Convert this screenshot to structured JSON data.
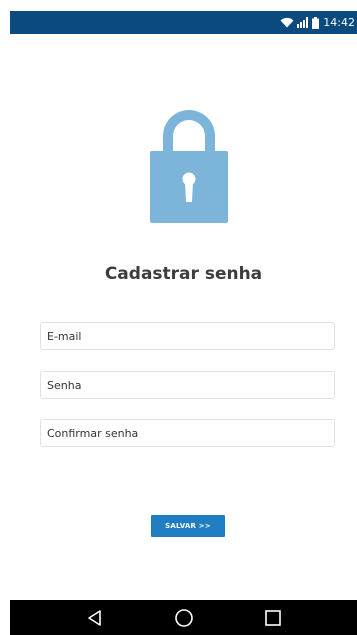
{
  "status_bar": {
    "time": "14:42",
    "icons": [
      "wifi-icon",
      "signal-icon",
      "battery-icon"
    ]
  },
  "lock": {
    "icon": "padlock-icon",
    "color": "#7db4d9"
  },
  "form": {
    "title": "Cadastrar senha",
    "email_placeholder": "E-mail",
    "password_placeholder": "Senha",
    "confirm_placeholder": "Confirmar senha",
    "save_label": "SALVAR >>"
  },
  "nav_bar": {
    "buttons": [
      "back-icon",
      "home-icon",
      "recents-icon"
    ]
  },
  "colors": {
    "status_bar": "#0b4a7e",
    "accent": "#1f7dc3",
    "title_text": "#3d3d3d"
  }
}
